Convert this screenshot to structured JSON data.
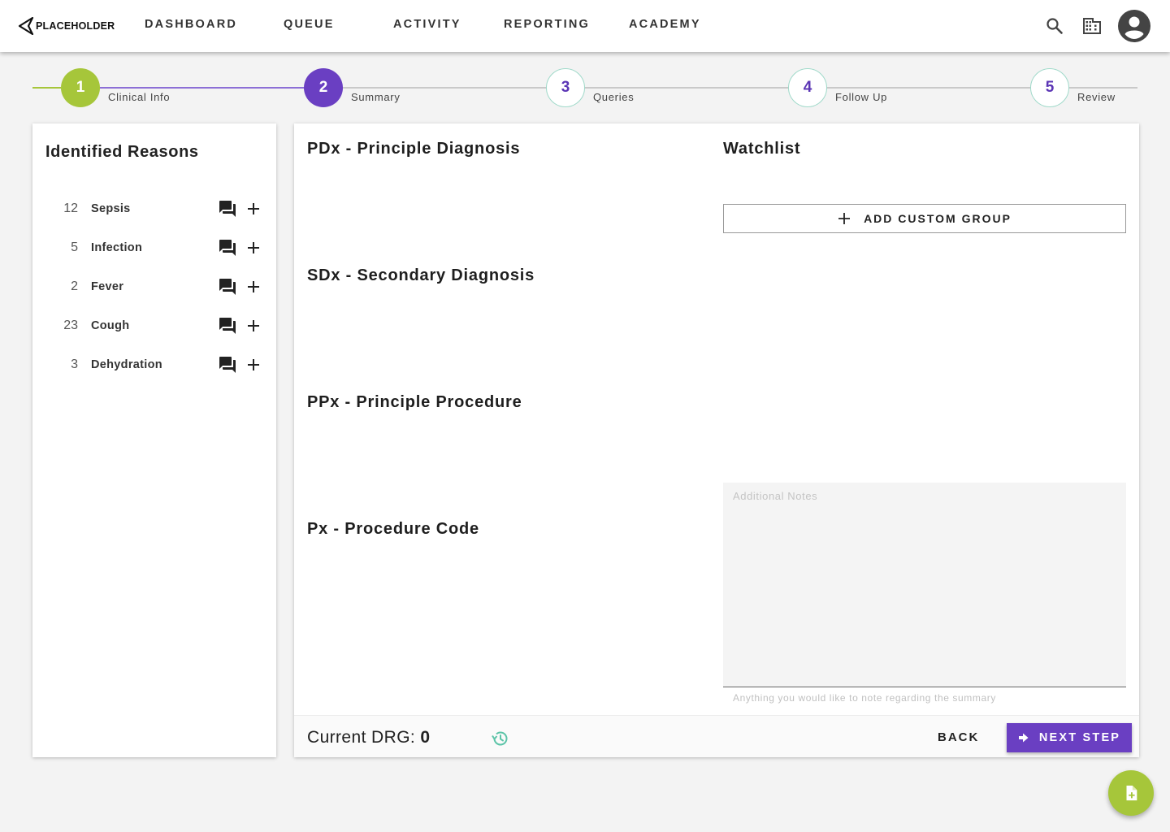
{
  "header": {
    "logo_text": "PLACEHOLDER",
    "nav": [
      "DASHBOARD",
      "QUEUE",
      "ACTIVITY",
      "REPORTING",
      "ACADEMY"
    ],
    "icons": [
      "search-icon",
      "building-icon",
      "account-circle-icon"
    ]
  },
  "stepper": {
    "steps": [
      {
        "number": "1",
        "label": "Clinical Info",
        "state": "done"
      },
      {
        "number": "2",
        "label": "Summary",
        "state": "active"
      },
      {
        "number": "3",
        "label": "Queries",
        "state": "todo"
      },
      {
        "number": "4",
        "label": "Follow Up",
        "state": "todo"
      },
      {
        "number": "5",
        "label": "Review",
        "state": "todo"
      }
    ]
  },
  "reasons": {
    "title": "Identified Reasons",
    "items": [
      {
        "count": "12",
        "name": "Sepsis"
      },
      {
        "count": "5",
        "name": "Infection"
      },
      {
        "count": "2",
        "name": "Fever"
      },
      {
        "count": "23",
        "name": "Cough"
      },
      {
        "count": "3",
        "name": "Dehydration"
      }
    ]
  },
  "sections": {
    "pdx": "PDx - Principle Diagnosis",
    "sdx": "SDx - Secondary Diagnosis",
    "ppx": "PPx - Principle Procedure",
    "px": "Px - Procedure Code"
  },
  "watchlist": {
    "title": "Watchlist",
    "add_group_label": "ADD CUSTOM GROUP"
  },
  "notes": {
    "placeholder": "Additional Notes",
    "helper": "Anything you would like to note regarding the summary"
  },
  "footer": {
    "drg_label": "Current DRG: ",
    "drg_value": "0",
    "back_label": "BACK",
    "next_label": "NEXT STEP"
  },
  "colors": {
    "primary": "#6a3fc2",
    "accent": "#a6c63a",
    "step_outline": "#9fd9c9",
    "history_icon": "#5cc4a8"
  }
}
